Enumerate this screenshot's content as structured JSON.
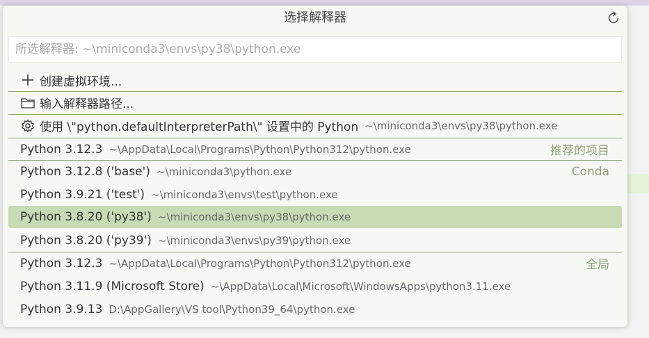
{
  "title": "选择解释器",
  "input": {
    "placeholder": "所选解释器: ~\\miniconda3\\envs\\py38\\python.exe"
  },
  "actions": [
    {
      "icon": "plus-icon",
      "label": "创建虚拟环境..."
    },
    {
      "icon": "folder-icon",
      "label": "输入解释器路径..."
    },
    {
      "icon": "gear-icon",
      "label": "使用 \\\"python.defaultInterpreterPath\\\" 设置中的 Python",
      "desc": "~\\miniconda3\\envs\\py38\\python.exe"
    }
  ],
  "interpreters": [
    {
      "label": "Python 3.12.3",
      "desc": "~\\AppData\\Local\\Programs\\Python\\Python312\\python.exe",
      "group": "推荐的项目"
    },
    {
      "label": "Python 3.12.8 ('base')",
      "desc": "~\\miniconda3\\python.exe",
      "group": "Conda"
    },
    {
      "label": "Python 3.9.21 ('test')",
      "desc": "~\\miniconda3\\envs\\test\\python.exe",
      "group": ""
    },
    {
      "label": "Python 3.8.20 ('py38')",
      "desc": "~\\miniconda3\\envs\\py38\\python.exe",
      "group": "",
      "selected": true
    },
    {
      "label": "Python 3.8.20 ('py39')",
      "desc": "~\\miniconda3\\envs\\py39\\python.exe",
      "group": ""
    },
    {
      "label": "Python 3.12.3",
      "desc": "~\\AppData\\Local\\Programs\\Python\\Python312\\python.exe",
      "group": "全局"
    },
    {
      "label": "Python 3.11.9 (Microsoft Store)",
      "desc": "~\\AppData\\Local\\Microsoft\\WindowsApps\\python3.11.exe",
      "group": ""
    },
    {
      "label": "Python 3.9.13",
      "desc": "D:\\AppGallery\\VS tool\\Python39_64\\python.exe",
      "group": ""
    }
  ],
  "colors": {
    "selected_bg": "#c8dbb4",
    "separator": "#8fa377",
    "group_label": "#8fa377"
  }
}
